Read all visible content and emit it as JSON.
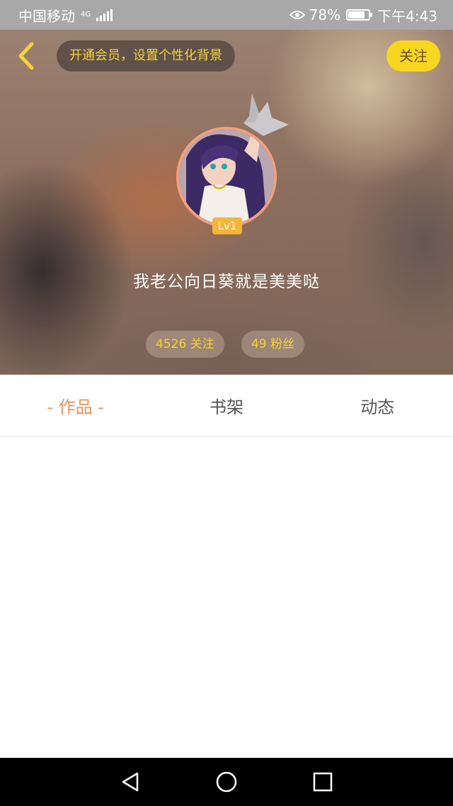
{
  "status_bar": {
    "carrier": "中国移动",
    "network": "4G",
    "battery": "78%",
    "time": "下午4:43"
  },
  "header": {
    "vip_banner": "开通会员，设置个性化背景",
    "follow_label": "关注",
    "level": "Lv1",
    "username": "我老公向日葵就是美美哒",
    "following": "4526 关注",
    "fans": "49 粉丝"
  },
  "tabs": [
    {
      "label": "- 作品 -",
      "active": true
    },
    {
      "label": "书架",
      "active": false
    },
    {
      "label": "动态",
      "active": false
    }
  ],
  "icons": {
    "back": "chevron-left-icon",
    "crown": "crown-icon",
    "nav_back": "triangle-back-icon",
    "nav_home": "circle-home-icon",
    "nav_recents": "square-recents-icon"
  },
  "colors": {
    "accent_yellow": "#f7d622",
    "active_tab": "#e8925a",
    "level_badge": "#f5b43a",
    "avatar_border": "#f0a07e"
  }
}
